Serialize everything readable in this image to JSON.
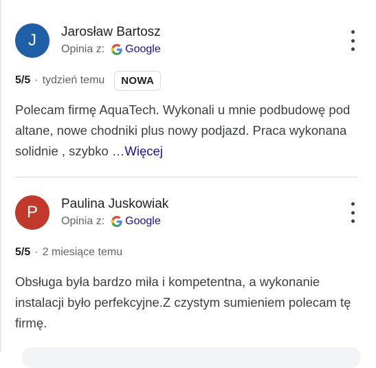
{
  "colors": {
    "avatar_1": "#1f5fa8",
    "avatar_2": "#c0392b",
    "link": "#1a0dab"
  },
  "reviews": [
    {
      "initial": "J",
      "author": "Jarosław Bartosz",
      "source_prefix": "Opinia z:",
      "source_name": "Google",
      "score": "5/5",
      "separator": "·",
      "time": "tydzień temu",
      "badge": "NOWA",
      "text": "Polecam firmę AquaTech. Wykonali u mnie podbudowę pod altane, nowe chodniki plus nowy podjazd. Praca wykonana solidnie , szybko …",
      "more": "Więcej",
      "menu_icon": "more-vert-icon"
    },
    {
      "initial": "P",
      "author": "Paulina Juskowiak",
      "source_prefix": "Opinia z:",
      "source_name": "Google",
      "score": "5/5",
      "separator": "·",
      "time": "2 miesiące temu",
      "text": "Obsługa była bardzo miła i kompetentna, a wykonanie instalacji było perfekcyjne.Z czystym sumieniem polecam tę firmę.",
      "menu_icon": "more-vert-icon"
    }
  ]
}
